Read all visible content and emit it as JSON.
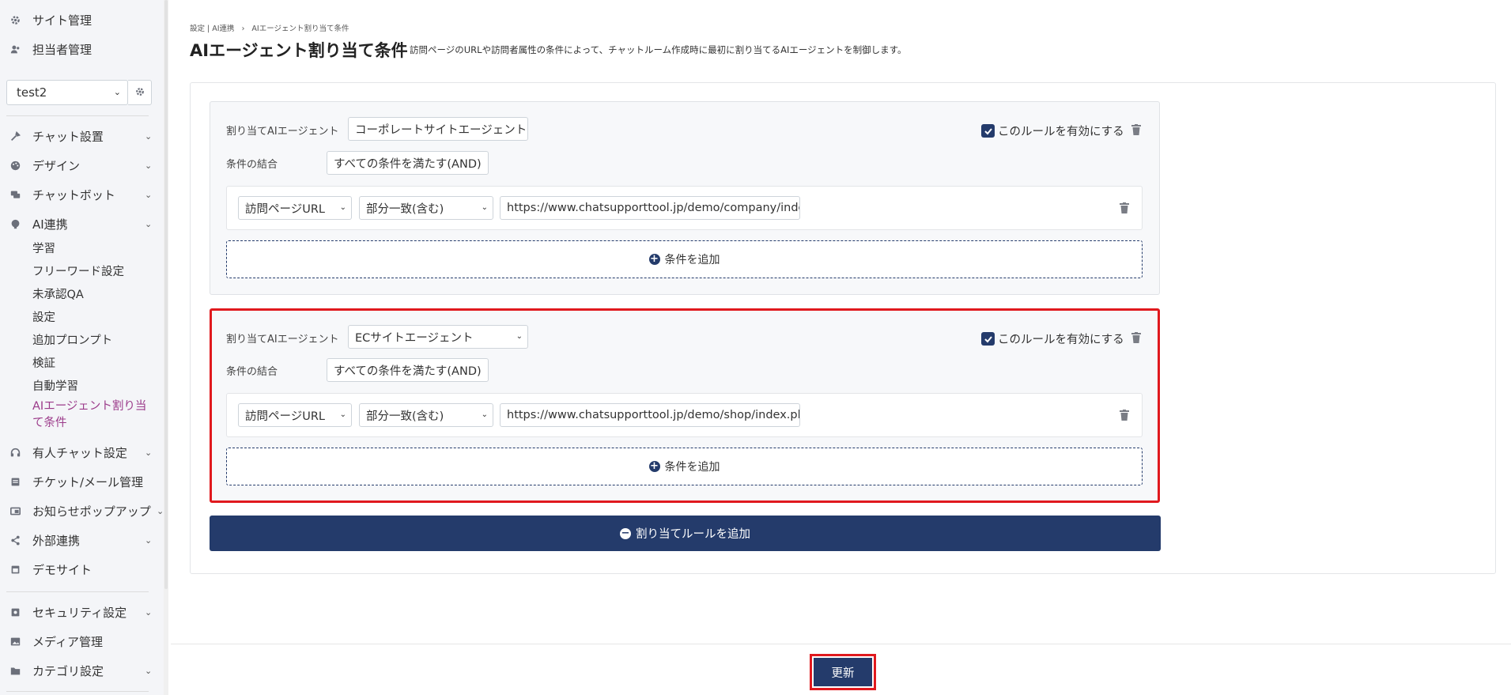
{
  "sidebar": {
    "top_items": [
      {
        "label": "サイト管理",
        "icon": "gears-icon"
      },
      {
        "label": "担当者管理",
        "icon": "users-icon"
      }
    ],
    "site_select": {
      "value": "test2"
    },
    "menu": [
      {
        "label": "チャット設置",
        "icon": "tools-icon"
      },
      {
        "label": "デザイン",
        "icon": "palette-icon"
      },
      {
        "label": "チャットボット",
        "icon": "comments-icon"
      },
      {
        "label": "AI連携",
        "icon": "brain-icon"
      }
    ],
    "ai_sub": [
      {
        "label": "学習"
      },
      {
        "label": "フリーワード設定"
      },
      {
        "label": "未承認QA"
      },
      {
        "label": "設定"
      },
      {
        "label": "追加プロンプト"
      },
      {
        "label": "検証"
      },
      {
        "label": "自動学習"
      }
    ],
    "ai_active": {
      "line1": "AIエージェント割り当",
      "line2": "て条件"
    },
    "menu2": [
      {
        "label": "有人チャット設定",
        "icon": "headset-icon"
      },
      {
        "label": "チケット/メール管理",
        "icon": "ticket-icon"
      },
      {
        "label": "お知らせポップアップ",
        "icon": "popup-icon"
      },
      {
        "label": "外部連携",
        "icon": "share-icon"
      },
      {
        "label": "デモサイト",
        "icon": "browser-icon"
      }
    ],
    "menu3": [
      {
        "label": "セキュリティ設定",
        "icon": "shield-icon"
      },
      {
        "label": "メディア管理",
        "icon": "image-icon"
      },
      {
        "label": "カテゴリ設定",
        "icon": "folder-icon"
      }
    ]
  },
  "breadcrumb": {
    "part1": "設定 | AI連携",
    "separator": "›",
    "part2": "AIエージェント割り当て条件"
  },
  "page": {
    "title": "AIエージェント割り当て条件",
    "description": "訪問ページのURLや訪問者属性の条件によって、チャットルーム作成時に最初に割り当てるAIエージェントを制御します。"
  },
  "rules": [
    {
      "agent_label": "割り当てAIエージェント",
      "agent_value": "コーポレートサイトエージェント",
      "combine_label": "条件の結合",
      "combine_value": "すべての条件を満たす(AND)",
      "enable_label": "このルールを有効にする",
      "condition": {
        "field": "訪問ページURL",
        "operator": "部分一致(含む)",
        "value": "https://www.chatsupporttool.jp/demo/company/inde"
      },
      "add_condition_label": "条件を追加"
    },
    {
      "agent_label": "割り当てAIエージェント",
      "agent_value": "ECサイトエージェント",
      "combine_label": "条件の結合",
      "combine_value": "すべての条件を満たす(AND)",
      "enable_label": "このルールを有効にする",
      "condition": {
        "field": "訪問ページURL",
        "operator": "部分一致(含む)",
        "value": "https://www.chatsupporttool.jp/demo/shop/index.pl"
      },
      "add_condition_label": "条件を追加"
    }
  ],
  "add_rule_label": "割り当てルールを追加",
  "update_label": "更新",
  "colors": {
    "primary": "#243b6b",
    "highlight": "#e0191e",
    "active_link": "#9b3b8a"
  }
}
